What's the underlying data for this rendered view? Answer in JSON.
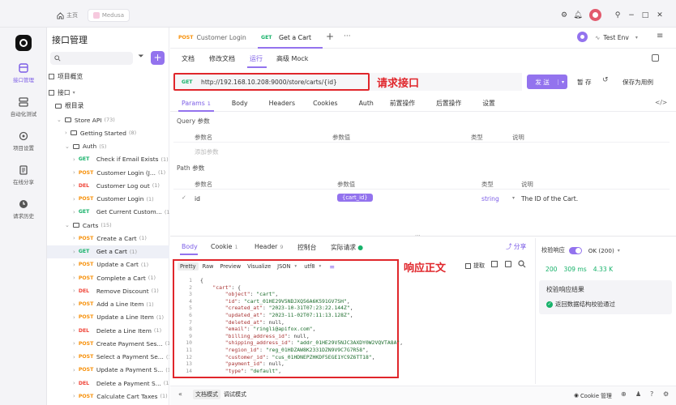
{
  "topbar": {
    "home_label": "主页",
    "workspace_label": "Medusa"
  },
  "rail": {
    "items": [
      {
        "label": "接口管理"
      },
      {
        "label": "自动化测试"
      },
      {
        "label": "项目设置"
      },
      {
        "label": "在线分享"
      },
      {
        "label": "请求历史"
      }
    ]
  },
  "tree": {
    "title": "接口管理",
    "overview": "项目概览",
    "api_section": "接口",
    "root": "根目录",
    "rows": [
      {
        "kind": "folder",
        "label": "Store API",
        "count": "(73)",
        "indent": 2,
        "open": true
      },
      {
        "kind": "folder",
        "label": "Getting Started",
        "count": "(8)",
        "indent": 3,
        "open": false
      },
      {
        "kind": "folder",
        "label": "Auth",
        "count": "(5)",
        "indent": 3,
        "open": true
      },
      {
        "kind": "api",
        "method": "GET",
        "label": "Check if Email Exists",
        "count": "(1)",
        "indent": 4
      },
      {
        "kind": "api",
        "method": "POST",
        "label": "Customer Login (J...",
        "count": "(1)",
        "indent": 4
      },
      {
        "kind": "api",
        "method": "DEL",
        "label": "Customer Log out",
        "count": "(1)",
        "indent": 4
      },
      {
        "kind": "api",
        "method": "POST",
        "label": "Customer Login",
        "count": "(1)",
        "indent": 4
      },
      {
        "kind": "api",
        "method": "GET",
        "label": "Get Current Custom...",
        "count": "(1)",
        "indent": 4
      },
      {
        "kind": "folder",
        "label": "Carts",
        "count": "(15)",
        "indent": 3,
        "open": true
      },
      {
        "kind": "api",
        "method": "POST",
        "label": "Create a Cart",
        "count": "(1)",
        "indent": 4
      },
      {
        "kind": "api",
        "method": "GET",
        "label": "Get a Cart",
        "count": "(1)",
        "indent": 4,
        "selected": true
      },
      {
        "kind": "api",
        "method": "POST",
        "label": "Update a Cart",
        "count": "(1)",
        "indent": 4
      },
      {
        "kind": "api",
        "method": "POST",
        "label": "Complete a Cart",
        "count": "(1)",
        "indent": 4
      },
      {
        "kind": "api",
        "method": "DEL",
        "label": "Remove Discount",
        "count": "(1)",
        "indent": 4
      },
      {
        "kind": "api",
        "method": "POST",
        "label": "Add a Line Item",
        "count": "(1)",
        "indent": 4
      },
      {
        "kind": "api",
        "method": "POST",
        "label": "Update a Line Item",
        "count": "(1)",
        "indent": 4
      },
      {
        "kind": "api",
        "method": "DEL",
        "label": "Delete a Line Item",
        "count": "(1)",
        "indent": 4
      },
      {
        "kind": "api",
        "method": "POST",
        "label": "Create Payment Ses...",
        "count": "(1)",
        "indent": 4
      },
      {
        "kind": "api",
        "method": "POST",
        "label": "Select a Payment Se...",
        "count": "(1)",
        "indent": 4
      },
      {
        "kind": "api",
        "method": "POST",
        "label": "Update a Payment S...",
        "count": "(1)",
        "indent": 4
      },
      {
        "kind": "api",
        "method": "DEL",
        "label": "Delete a Payment S...",
        "count": "(1)",
        "indent": 4
      },
      {
        "kind": "api",
        "method": "POST",
        "label": "Calculate Cart Taxes",
        "count": "(1)",
        "indent": 4
      }
    ]
  },
  "tabs": {
    "t1_method": "POST",
    "t1_label": "Customer Login",
    "t2_method": "GET",
    "t2_label": "Get a Cart",
    "env": "Test Env"
  },
  "subtabs": [
    "文档",
    "修改文档",
    "运行",
    "高级 Mock"
  ],
  "request": {
    "method": "GET",
    "url": "http://192.168.10.208:9000/store/carts/{id}",
    "annotation": "请求接口",
    "send": "发 送",
    "save_temp": "暂 存",
    "save_case": "保存为用例"
  },
  "param_tabs": [
    {
      "label": "Params",
      "count": "1"
    },
    {
      "label": "Body"
    },
    {
      "label": "Headers"
    },
    {
      "label": "Cookies"
    },
    {
      "label": "Auth"
    },
    {
      "label": "前置操作"
    },
    {
      "label": "后置操作"
    },
    {
      "label": "设置"
    }
  ],
  "query": {
    "title": "Query 参数",
    "headers": [
      "参数名",
      "参数值",
      "类型",
      "说明"
    ],
    "add_placeholder": "添加参数"
  },
  "path": {
    "title": "Path 参数",
    "headers": [
      "参数名",
      "参数值",
      "类型",
      "说明"
    ],
    "row": {
      "name": "id",
      "value": "{cart_id}",
      "type": "string",
      "desc": "The ID of the Cart."
    }
  },
  "response_tabs": {
    "body": "Body",
    "cookie": "Cookie",
    "cookie_count": "1",
    "header": "Header",
    "header_count": "9",
    "console": "控制台",
    "actual": "实际请求",
    "share": "分享"
  },
  "format_tabs": [
    "Pretty",
    "Raw",
    "Preview",
    "Visualize",
    "JSON",
    "utf8"
  ],
  "response_annotation": "响应正文",
  "extract": "提取",
  "code_lines": [
    [
      [
        "p",
        "{"
      ]
    ],
    [
      [
        "p",
        "    "
      ],
      [
        "k",
        "\"cart\""
      ],
      [
        "p",
        ": {"
      ]
    ],
    [
      [
        "p",
        "        "
      ],
      [
        "k",
        "\"object\""
      ],
      [
        "p",
        ": "
      ],
      [
        "s",
        "\"cart\""
      ],
      [
        "p",
        ","
      ]
    ],
    [
      [
        "p",
        "        "
      ],
      [
        "k",
        "\"id\""
      ],
      [
        "p",
        ": "
      ],
      [
        "s",
        "\"cart_01HE29V5NDJXQ56A6K591GV7SH\""
      ],
      [
        "p",
        ","
      ]
    ],
    [
      [
        "p",
        "        "
      ],
      [
        "k",
        "\"created_at\""
      ],
      [
        "p",
        ": "
      ],
      [
        "s",
        "\"2023-10-31T07:23:22.144Z\""
      ],
      [
        "p",
        ","
      ]
    ],
    [
      [
        "p",
        "        "
      ],
      [
        "k",
        "\"updated_at\""
      ],
      [
        "p",
        ": "
      ],
      [
        "s",
        "\"2023-11-02T07:11:13.128Z\""
      ],
      [
        "p",
        ","
      ]
    ],
    [
      [
        "p",
        "        "
      ],
      [
        "k",
        "\"deleted_at\""
      ],
      [
        "p",
        ": null,"
      ]
    ],
    [
      [
        "p",
        "        "
      ],
      [
        "k",
        "\"email\""
      ],
      [
        "p",
        ": "
      ],
      [
        "s",
        "\"ringli@apifox.com\""
      ],
      [
        "p",
        ","
      ]
    ],
    [
      [
        "p",
        "        "
      ],
      [
        "k",
        "\"billing_address_id\""
      ],
      [
        "p",
        ": null,"
      ]
    ],
    [
      [
        "p",
        "        "
      ],
      [
        "k",
        "\"shipping_address_id\""
      ],
      [
        "p",
        ": "
      ],
      [
        "s",
        "\"addr_01HE29V5NJC3AXDY0W2VQVTA8A\""
      ],
      [
        "p",
        ","
      ]
    ],
    [
      [
        "p",
        "        "
      ],
      [
        "k",
        "\"region_id\""
      ],
      [
        "p",
        ": "
      ],
      [
        "s",
        "\"reg_01HDZAW8K2331DZN9V9C7G7R58\""
      ],
      [
        "p",
        ","
      ]
    ],
    [
      [
        "p",
        "        "
      ],
      [
        "k",
        "\"customer_id\""
      ],
      [
        "p",
        ": "
      ],
      [
        "s",
        "\"cus_01HDNEPZHKDF5EGE1YC9Z6TT18\""
      ],
      [
        "p",
        ","
      ]
    ],
    [
      [
        "p",
        "        "
      ],
      [
        "k",
        "\"payment_id\""
      ],
      [
        "p",
        ": null,"
      ]
    ],
    [
      [
        "p",
        "        "
      ],
      [
        "k",
        "\"type\""
      ],
      [
        "p",
        ": "
      ],
      [
        "s",
        "\"default\""
      ],
      [
        "p",
        ","
      ]
    ]
  ],
  "validation": {
    "label": "校验响应",
    "status": "OK (200)",
    "code": "200",
    "time": "309 ms",
    "size": "4.33 K",
    "result_title": "校验响应结果",
    "result_text": "返回数据结构校验通过"
  },
  "footer": {
    "doc_mode": "文档模式",
    "debug_mode": "调试模式",
    "cookie_manage": "Cookie 管理"
  },
  "colors": {
    "accent": "#9373ee",
    "annotation_red": "#e0262b",
    "get": "#17b26a",
    "post": "#f79009",
    "del": "#f04438"
  }
}
